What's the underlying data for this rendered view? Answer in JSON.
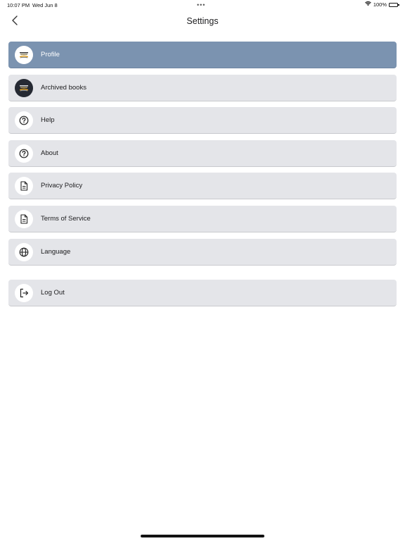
{
  "status_bar": {
    "time": "10:07 PM",
    "date": "Wed Jun 8",
    "dots": "•••",
    "battery": "100%"
  },
  "header": {
    "title": "Settings",
    "back_icon": "chevron-left-icon"
  },
  "menu": {
    "items": [
      {
        "label": "Profile",
        "icon": "profile-logo-icon"
      },
      {
        "label": "Archived books",
        "icon": "book-logo-icon"
      },
      {
        "label": "Help",
        "icon": "question-circle-icon"
      },
      {
        "label": "About",
        "icon": "question-circle-icon"
      },
      {
        "label": "Privacy Policy",
        "icon": "document-icon"
      },
      {
        "label": "Terms of Service",
        "icon": "document-icon"
      },
      {
        "label": "Language",
        "icon": "globe-icon"
      },
      {
        "label": "Log Out",
        "icon": "logout-icon"
      }
    ]
  },
  "colors": {
    "active_item": "#7b93b0",
    "item_bg": "#e4e5e9"
  }
}
